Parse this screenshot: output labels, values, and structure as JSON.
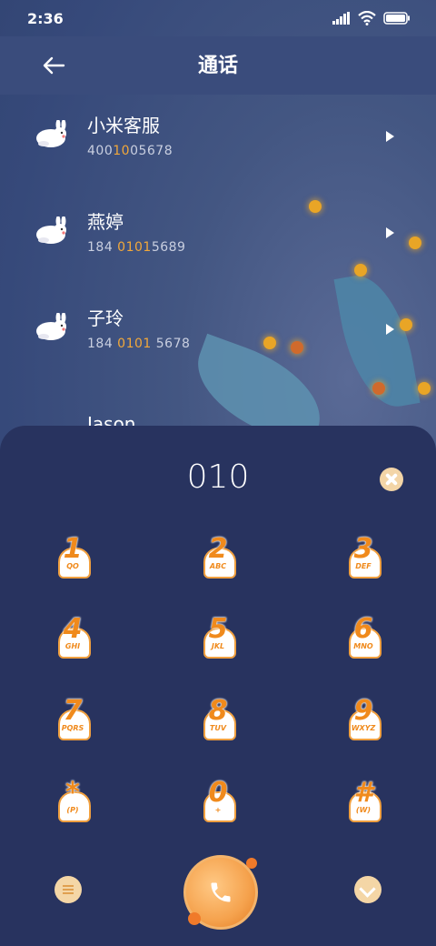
{
  "status": {
    "time": "2:36"
  },
  "header": {
    "title": "通话"
  },
  "contacts": [
    {
      "name": "小米客服",
      "num_pre": "400",
      "num_hl": "10",
      "num_post": "05678"
    },
    {
      "name": "燕婷",
      "num_pre": "184 ",
      "num_hl": "0101",
      "num_post": "5689"
    },
    {
      "name": "子玲",
      "num_pre": "184 ",
      "num_hl": "0101",
      "num_post": " 5678"
    },
    {
      "name": "Jason"
    }
  ],
  "dialer": {
    "number": "010",
    "keys": [
      {
        "digit": "1",
        "letters": "QO"
      },
      {
        "digit": "2",
        "letters": "ABC"
      },
      {
        "digit": "3",
        "letters": "DEF"
      },
      {
        "digit": "4",
        "letters": "GHI"
      },
      {
        "digit": "5",
        "letters": "JKL"
      },
      {
        "digit": "6",
        "letters": "MNO"
      },
      {
        "digit": "7",
        "letters": "PQRS"
      },
      {
        "digit": "8",
        "letters": "TUV"
      },
      {
        "digit": "9",
        "letters": "WXYZ"
      },
      {
        "digit": "*",
        "letters": "(P)"
      },
      {
        "digit": "0",
        "letters": "+"
      },
      {
        "digit": "#",
        "letters": "(W)"
      }
    ]
  },
  "colors": {
    "panel": "#28335f",
    "accent": "#f08a1c",
    "highlight": "#f2a83a"
  }
}
